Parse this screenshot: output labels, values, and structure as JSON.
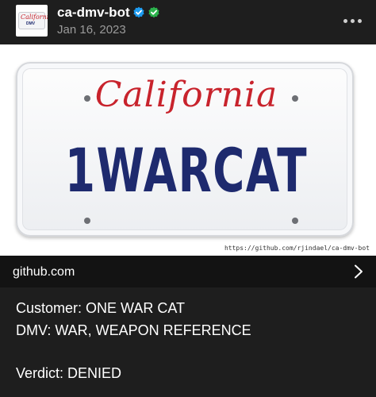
{
  "post": {
    "username": "ca-dmv-bot",
    "date": "Jan 16, 2023",
    "avatar_text": {
      "state": "California",
      "agency": "DMV"
    },
    "badges": [
      {
        "icon": "verified-blue-check-icon",
        "color": "#1d9bf0"
      },
      {
        "icon": "verified-green-check-icon",
        "color": "#2bb24c"
      }
    ],
    "more_icon": "more-horizontal-icon"
  },
  "preview": {
    "plate_state": "California",
    "plate_number": "1WARCAT",
    "watermark": "https://github.com/rjindael/ca-dmv-bot",
    "colors": {
      "state_text": "#c8232c",
      "plate_number": "#1e2a6e"
    }
  },
  "link": {
    "domain": "github.com",
    "icon": "chevron-right-icon"
  },
  "body": {
    "customer": "Customer: ONE WAR CAT",
    "dmv": "DMV: WAR, WEAPON REFERENCE",
    "verdict": "Verdict: DENIED"
  }
}
